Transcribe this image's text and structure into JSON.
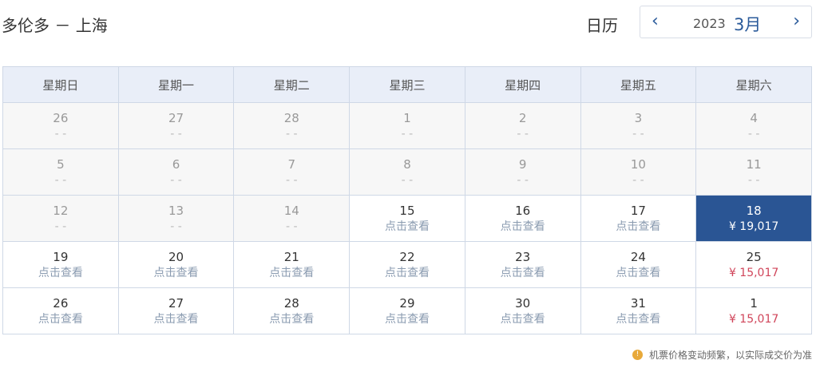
{
  "header": {
    "route": "多伦多 － 上海",
    "calendar_label": "日历",
    "year": "2023",
    "month": "3月",
    "prev_icon": "chevron-left-icon",
    "next_icon": "chevron-right-icon"
  },
  "weekdays": [
    "星期日",
    "星期一",
    "星期二",
    "星期三",
    "星期四",
    "星期五",
    "星期六"
  ],
  "weeks": [
    [
      {
        "day": "26",
        "sub": "- -",
        "state": "past"
      },
      {
        "day": "27",
        "sub": "- -",
        "state": "past"
      },
      {
        "day": "28",
        "sub": "- -",
        "state": "past"
      },
      {
        "day": "1",
        "sub": "- -",
        "state": "past"
      },
      {
        "day": "2",
        "sub": "- -",
        "state": "past"
      },
      {
        "day": "3",
        "sub": "- -",
        "state": "past"
      },
      {
        "day": "4",
        "sub": "- -",
        "state": "past"
      }
    ],
    [
      {
        "day": "5",
        "sub": "- -",
        "state": "past"
      },
      {
        "day": "6",
        "sub": "- -",
        "state": "past"
      },
      {
        "day": "7",
        "sub": "- -",
        "state": "past"
      },
      {
        "day": "8",
        "sub": "- -",
        "state": "past"
      },
      {
        "day": "9",
        "sub": "- -",
        "state": "past"
      },
      {
        "day": "10",
        "sub": "- -",
        "state": "past"
      },
      {
        "day": "11",
        "sub": "- -",
        "state": "past"
      }
    ],
    [
      {
        "day": "12",
        "sub": "- -",
        "state": "past"
      },
      {
        "day": "13",
        "sub": "- -",
        "state": "past"
      },
      {
        "day": "14",
        "sub": "- -",
        "state": "past"
      },
      {
        "day": "15",
        "sub": "点击查看",
        "state": "view"
      },
      {
        "day": "16",
        "sub": "点击查看",
        "state": "view"
      },
      {
        "day": "17",
        "sub": "点击查看",
        "state": "view"
      },
      {
        "day": "18",
        "sub": "¥ 19,017",
        "state": "sel"
      }
    ],
    [
      {
        "day": "19",
        "sub": "点击查看",
        "state": "view"
      },
      {
        "day": "20",
        "sub": "点击查看",
        "state": "view"
      },
      {
        "day": "21",
        "sub": "点击查看",
        "state": "view"
      },
      {
        "day": "22",
        "sub": "点击查看",
        "state": "view"
      },
      {
        "day": "23",
        "sub": "点击查看",
        "state": "view"
      },
      {
        "day": "24",
        "sub": "点击查看",
        "state": "view"
      },
      {
        "day": "25",
        "sub": "¥ 15,017",
        "state": "price"
      }
    ],
    [
      {
        "day": "26",
        "sub": "点击查看",
        "state": "view"
      },
      {
        "day": "27",
        "sub": "点击查看",
        "state": "view"
      },
      {
        "day": "28",
        "sub": "点击查看",
        "state": "view"
      },
      {
        "day": "29",
        "sub": "点击查看",
        "state": "view"
      },
      {
        "day": "30",
        "sub": "点击查看",
        "state": "view"
      },
      {
        "day": "31",
        "sub": "点击查看",
        "state": "view"
      },
      {
        "day": "1",
        "sub": "¥ 15,017",
        "state": "price"
      }
    ]
  ],
  "note": "机票价格变动频繁，以实际成交价为准",
  "colors": {
    "accent": "#2a5594",
    "price": "#d0455a",
    "header_bg": "#e9eef8"
  }
}
